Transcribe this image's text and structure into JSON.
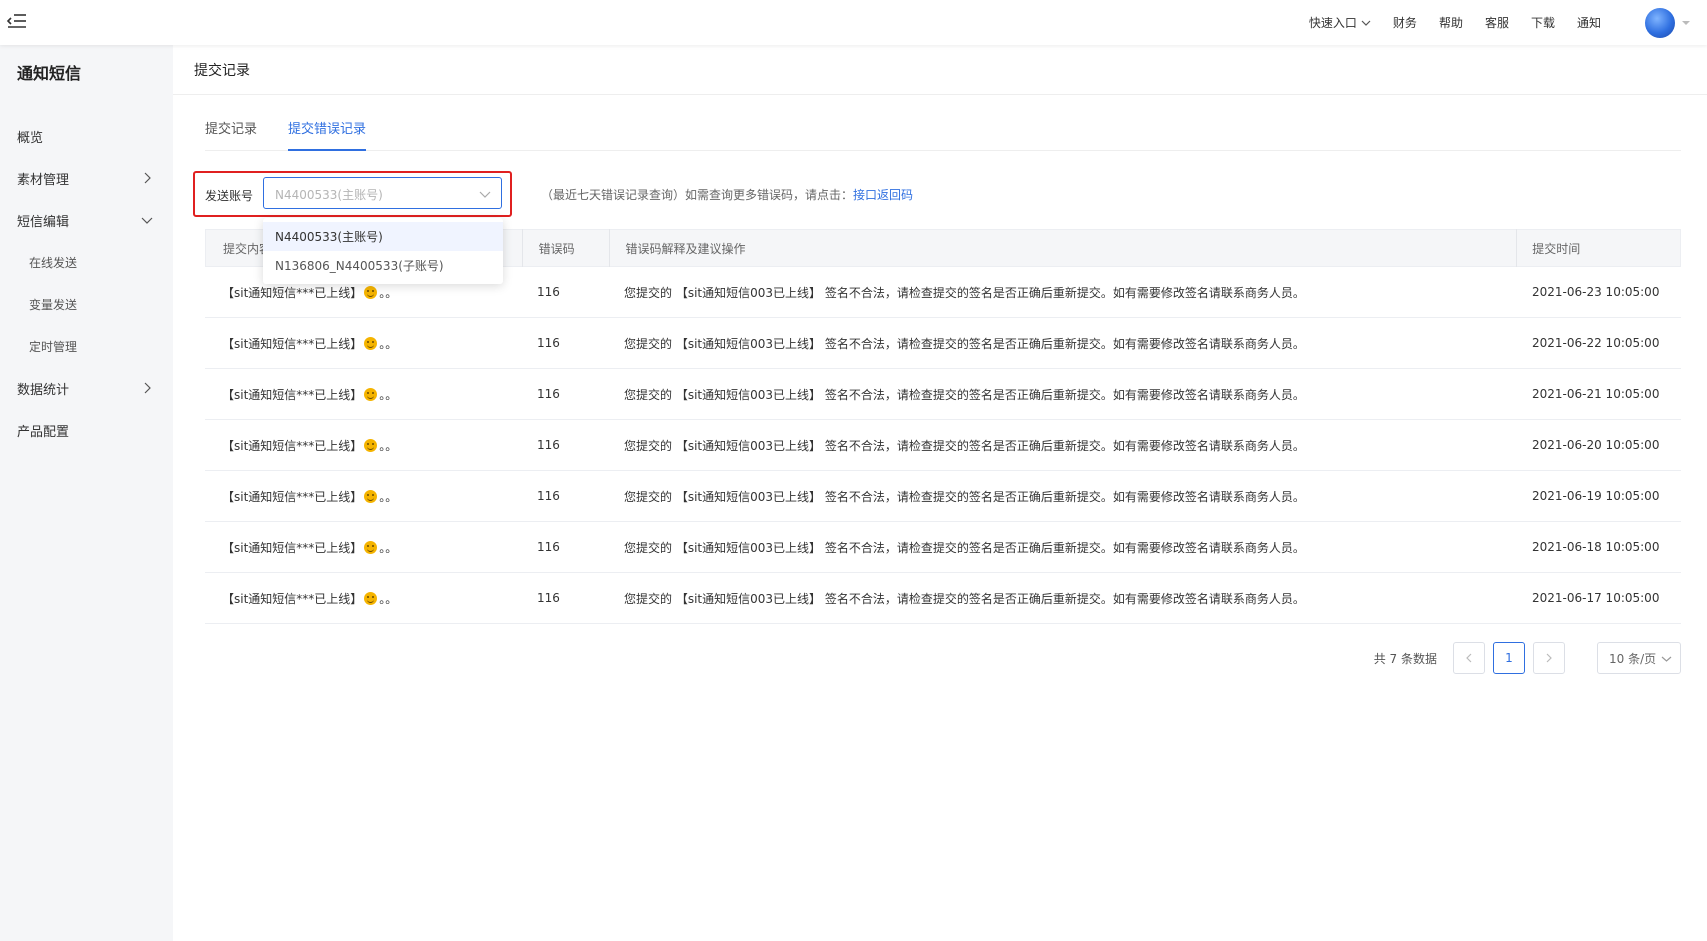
{
  "topbar": {
    "nav": [
      {
        "label": "快速入口",
        "has_dropdown": true
      },
      {
        "label": "财务"
      },
      {
        "label": "帮助"
      },
      {
        "label": "客服"
      },
      {
        "label": "下载"
      },
      {
        "label": "通知"
      }
    ]
  },
  "sidebar": {
    "brand": "通知短信",
    "items": [
      {
        "label": "概览"
      },
      {
        "label": "素材管理",
        "arrow": "right"
      },
      {
        "label": "短信编辑",
        "arrow": "down"
      },
      {
        "label": "在线发送",
        "sub": true
      },
      {
        "label": "变量发送",
        "sub": true
      },
      {
        "label": "定时管理",
        "sub": true
      },
      {
        "label": "数据统计",
        "arrow": "right"
      },
      {
        "label": "产品配置"
      }
    ]
  },
  "main": {
    "page_title": "提交记录",
    "tabs": [
      {
        "label": "提交记录",
        "active": false
      },
      {
        "label": "提交错误记录",
        "active": true
      }
    ],
    "filter": {
      "label": "发送账号",
      "selected": "N4400533(主账号)",
      "options": [
        "N4400533(主账号)",
        "N136806_N4400533(子账号)"
      ]
    },
    "hint": {
      "text": "（最近七天错误记录查询）如需查询更多错误码，请点击：",
      "link": "接口返回码"
    },
    "table": {
      "columns": [
        "提交内容",
        "错误码",
        "错误码解释及建议操作",
        "提交时间"
      ],
      "rows": [
        {
          "content_pre": "【sit通知短信***已上线】",
          "content_post": "。。",
          "code": "116",
          "desc": "您提交的 【sit通知短信003已上线】 签名不合法，请检查提交的签名是否正确后重新提交。如有需要修改签名请联系商务人员。",
          "time": "2021-06-23 10:05:00"
        },
        {
          "content_pre": "【sit通知短信***已上线】",
          "content_post": "。。",
          "code": "116",
          "desc": "您提交的 【sit通知短信003已上线】 签名不合法，请检查提交的签名是否正确后重新提交。如有需要修改签名请联系商务人员。",
          "time": "2021-06-22 10:05:00"
        },
        {
          "content_pre": "【sit通知短信***已上线】",
          "content_post": "。。",
          "code": "116",
          "desc": "您提交的 【sit通知短信003已上线】 签名不合法，请检查提交的签名是否正确后重新提交。如有需要修改签名请联系商务人员。",
          "time": "2021-06-21 10:05:00"
        },
        {
          "content_pre": "【sit通知短信***已上线】",
          "content_post": "。。",
          "code": "116",
          "desc": "您提交的 【sit通知短信003已上线】 签名不合法，请检查提交的签名是否正确后重新提交。如有需要修改签名请联系商务人员。",
          "time": "2021-06-20 10:05:00"
        },
        {
          "content_pre": "【sit通知短信***已上线】",
          "content_post": "。。",
          "code": "116",
          "desc": "您提交的 【sit通知短信003已上线】 签名不合法，请检查提交的签名是否正确后重新提交。如有需要修改签名请联系商务人员。",
          "time": "2021-06-19 10:05:00"
        },
        {
          "content_pre": "【sit通知短信***已上线】",
          "content_post": "。。",
          "code": "116",
          "desc": "您提交的 【sit通知短信003已上线】 签名不合法，请检查提交的签名是否正确后重新提交。如有需要修改签名请联系商务人员。",
          "time": "2021-06-18 10:05:00"
        },
        {
          "content_pre": "【sit通知短信***已上线】",
          "content_post": "。。",
          "code": "116",
          "desc": "您提交的 【sit通知短信003已上线】 签名不合法，请检查提交的签名是否正确后重新提交。如有需要修改签名请联系商务人员。",
          "time": "2021-06-17 10:05:00"
        }
      ]
    },
    "pagination": {
      "total": "共 7 条数据",
      "current_page": "1",
      "page_size": "10 条/页"
    }
  },
  "colors": {
    "accent": "#2f6fe0",
    "highlight_border": "#e02020",
    "sidebar_bg": "#f5f6f8"
  },
  "icons": {
    "menu_toggle": "menu-fold-icon",
    "avatar": "user-avatar",
    "emoji": "smiley-emoji-icon"
  }
}
